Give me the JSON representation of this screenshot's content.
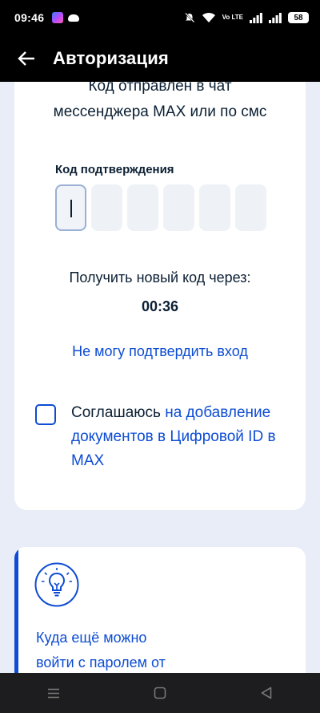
{
  "status_bar": {
    "time": "09:46",
    "network": "Vo LTE",
    "battery": "58"
  },
  "header": {
    "title": "Авторизация",
    "back_icon": "arrow-left-icon"
  },
  "auth": {
    "sent_message_line1": "Код отправлен в чат",
    "sent_message_line2": "мессенджера MAX или по смс",
    "code_label": "Код подтверждения",
    "code_digits": [
      "",
      "",
      "",
      "",
      "",
      ""
    ],
    "resend_label": "Получить новый код через:",
    "timer": "00:36",
    "cant_confirm_link": "Не могу подтвердить вход",
    "agree_prefix": "Соглашаюсь",
    "agree_link": "на добавление документов в Цифровой ID в MAX"
  },
  "tip": {
    "icon": "lightbulb-icon",
    "text_line1": "Куда ещё можно",
    "text_line2": "войти с паролем от"
  },
  "colors": {
    "accent": "#0d4cd3",
    "text": "#0b1f33",
    "background": "#e9edf7"
  }
}
